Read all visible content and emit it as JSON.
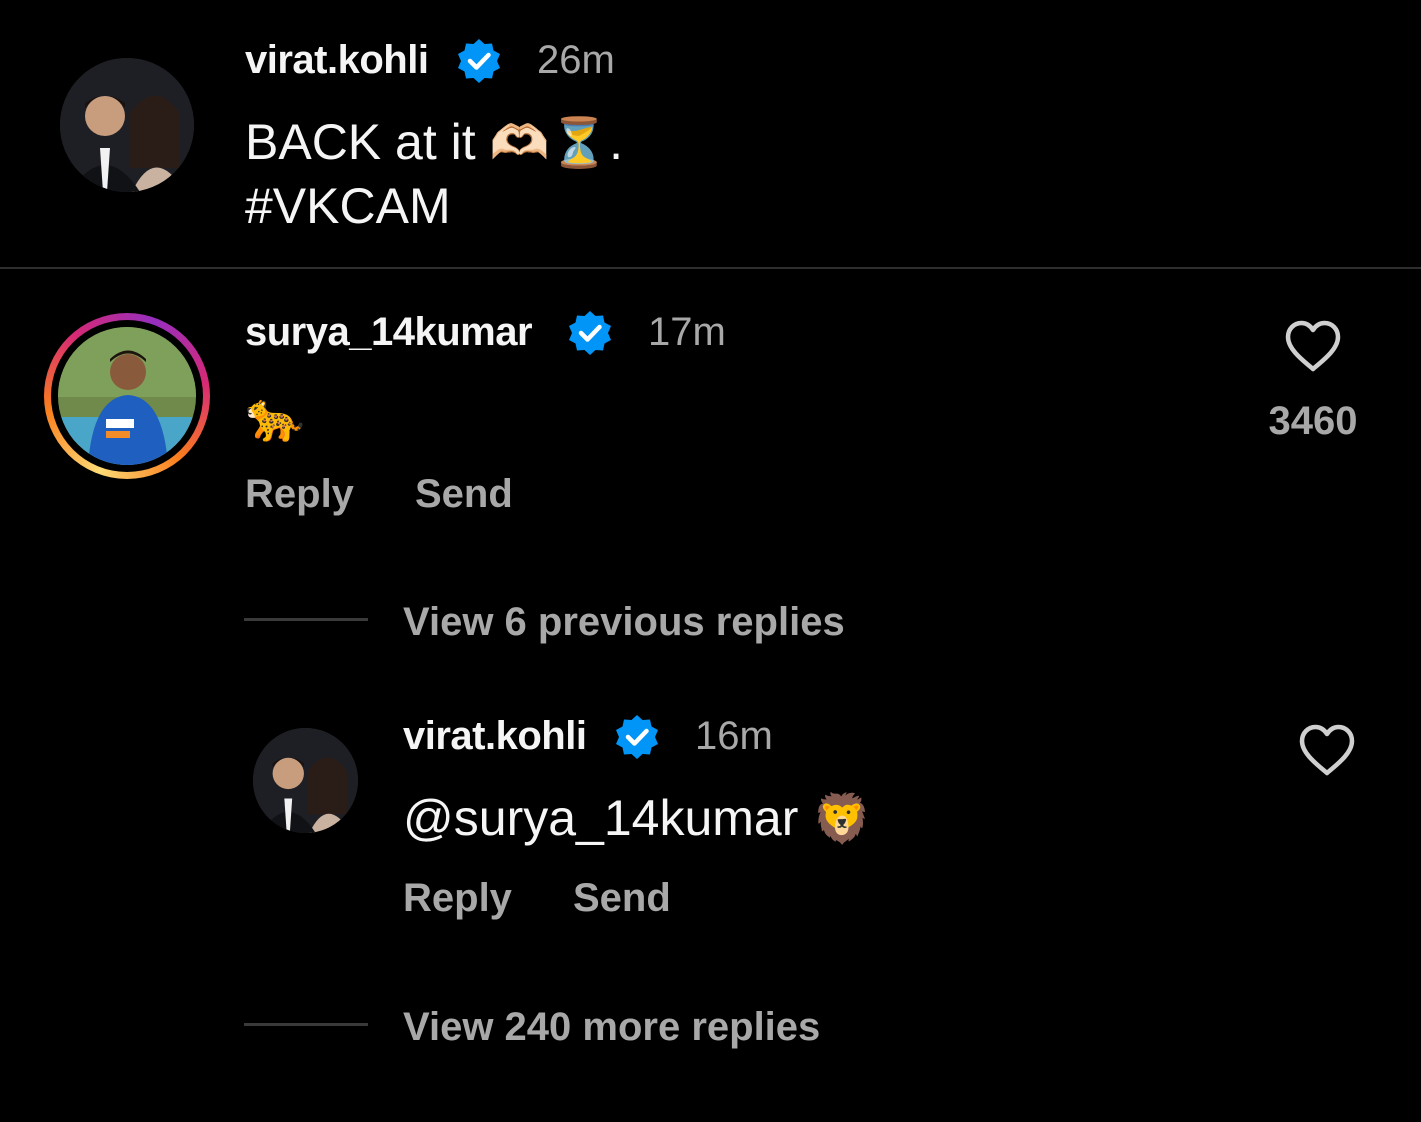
{
  "post": {
    "username": "virat.kohli",
    "time": "26m",
    "caption_line1": "BACK at it",
    "caption_emoji": "🫶🏻⏳",
    "caption_dot": ".",
    "caption_line2": "#VKCAM"
  },
  "comment": {
    "username": "surya_14kumar",
    "time": "17m",
    "text_emoji": "🐆",
    "like_count": "3460",
    "reply_label": "Reply",
    "send_label": "Send",
    "view_previous_label": "View 6 previous replies"
  },
  "reply": {
    "username": "virat.kohli",
    "time": "16m",
    "text": "@surya_14kumar",
    "text_emoji": "🦁",
    "reply_label": "Reply",
    "send_label": "Send"
  },
  "view_more_label": "View 240 more replies",
  "colors": {
    "background": "#000000",
    "primary_text": "#f5f5f5",
    "secondary_text": "#a8a8a8",
    "verified_badge": "#0095f6",
    "divider": "#3a3a3a"
  },
  "icons": {
    "verified": "verified-badge-icon",
    "like": "heart-outline-icon"
  }
}
